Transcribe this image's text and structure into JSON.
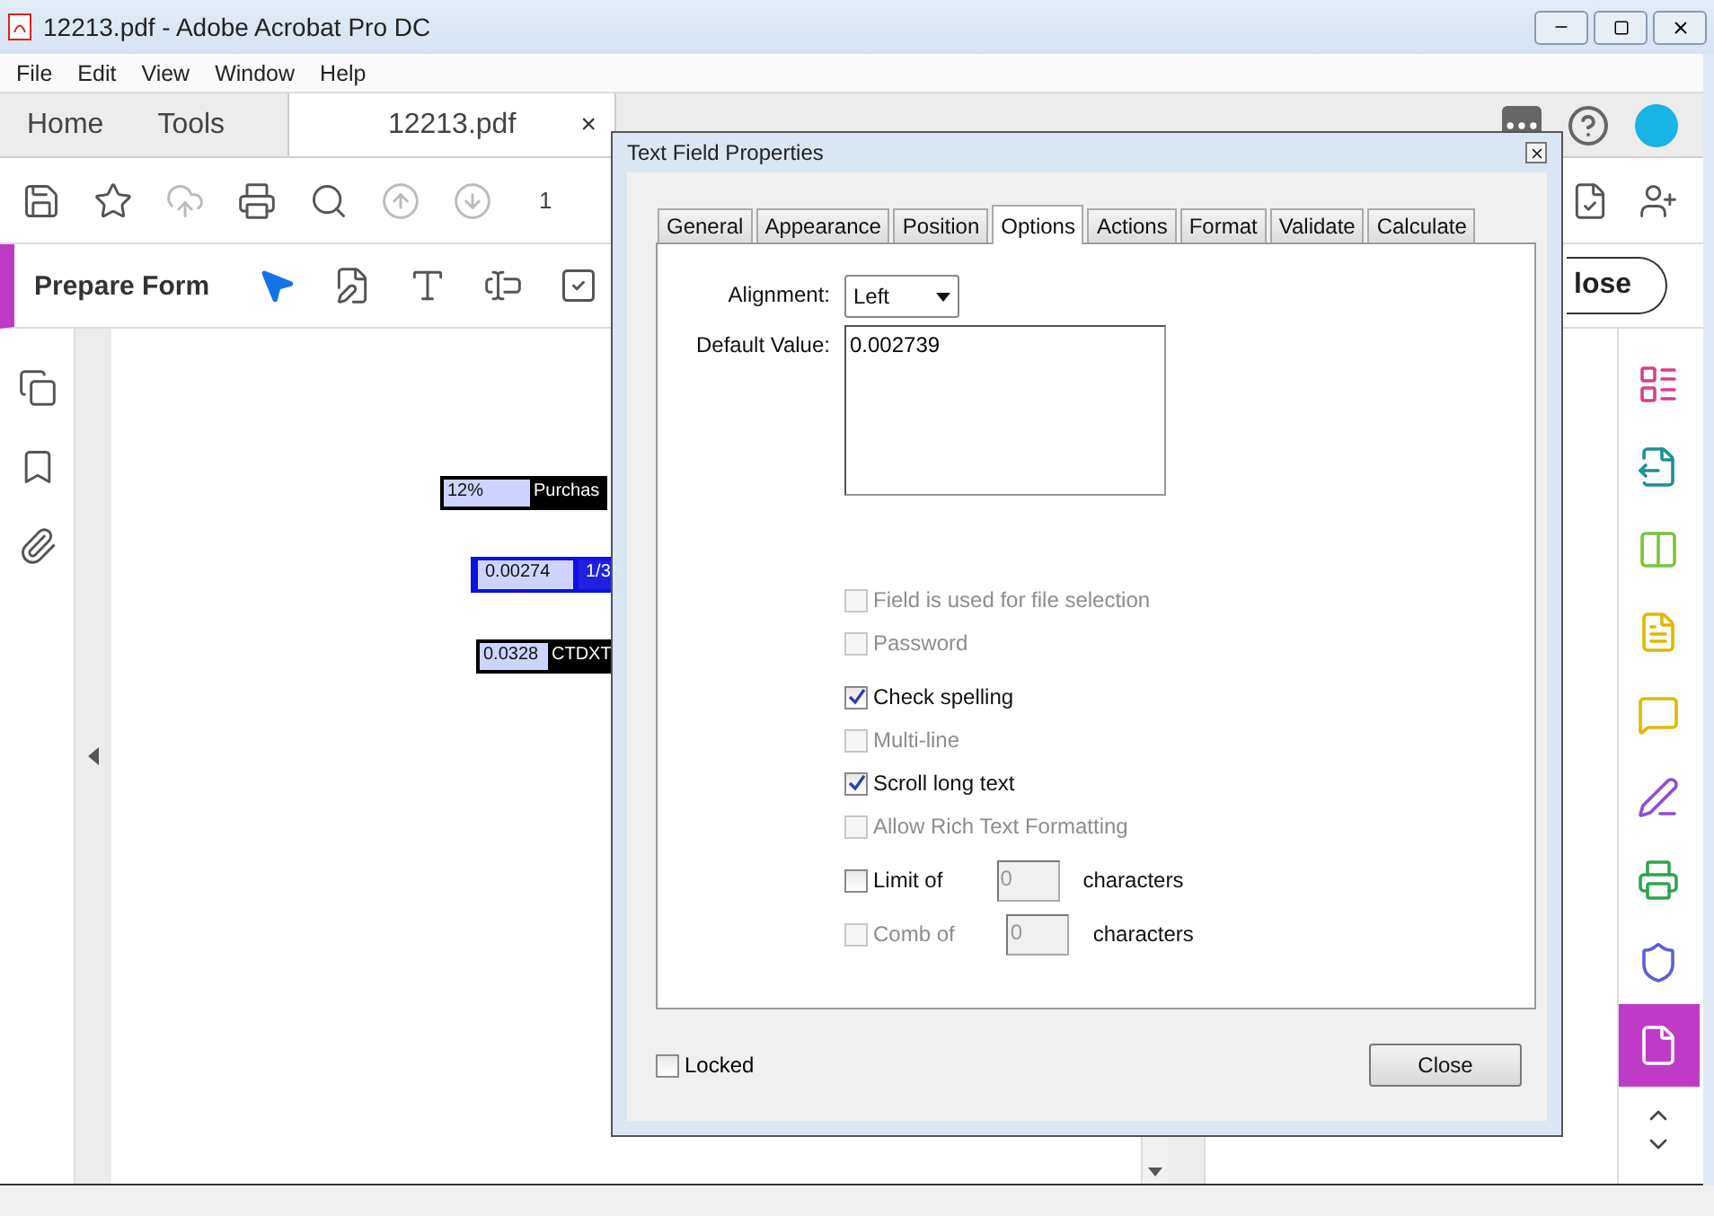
{
  "window": {
    "title": "12213.pdf - Adobe Acrobat Pro DC"
  },
  "menu": [
    "File",
    "Edit",
    "View",
    "Window",
    "Help"
  ],
  "app_tabs": [
    {
      "label": "Home",
      "selected": false
    },
    {
      "label": "Tools",
      "selected": false
    },
    {
      "label": "12213.pdf",
      "selected": true,
      "closable": "×"
    }
  ],
  "toolbar": {
    "page_number": "1"
  },
  "prepare_form": {
    "title": "Prepare Form",
    "close_button": "lose"
  },
  "page_fields": [
    {
      "value": "12%",
      "label": "Purchas",
      "selected": false
    },
    {
      "value": "0.00274",
      "label": "1/3",
      "selected": true
    },
    {
      "value": "0.0328",
      "label": "CTDXT",
      "selected": false
    }
  ],
  "tool_rail": [
    {
      "color": "#d63f8c",
      "selected": false
    },
    {
      "color": "#1f8f8f",
      "selected": false
    },
    {
      "color": "#7cc242",
      "selected": false
    },
    {
      "color": "#e0b800",
      "selected": false
    },
    {
      "color": "#e0b800",
      "selected": false
    },
    {
      "color": "#8a4fd8",
      "selected": false
    },
    {
      "color": "#2ea44f",
      "selected": false
    },
    {
      "color": "#5b5fd6",
      "selected": false
    },
    {
      "color": "#ffffff",
      "selected": true
    }
  ],
  "dialog": {
    "title": "Text Field Properties",
    "tabs": [
      {
        "label": "General",
        "selected": false
      },
      {
        "label": "Appearance",
        "selected": false
      },
      {
        "label": "Position",
        "selected": false
      },
      {
        "label": "Options",
        "selected": true
      },
      {
        "label": "Actions",
        "selected": false
      },
      {
        "label": "Format",
        "selected": false
      },
      {
        "label": "Validate",
        "selected": false
      },
      {
        "label": "Calculate",
        "selected": false
      }
    ],
    "alignment": {
      "label": "Alignment:",
      "value": "Left"
    },
    "default_value": {
      "label": "Default Value:",
      "value": "0.002739"
    },
    "options": [
      {
        "kind": "check",
        "label": "Field is used for file selection",
        "checked": false,
        "disabled": true
      },
      {
        "kind": "check",
        "label": "Password",
        "checked": false,
        "disabled": true
      },
      {
        "kind": "check",
        "label": "Check spelling",
        "checked": true,
        "disabled": false
      },
      {
        "kind": "check",
        "label": "Multi-line",
        "checked": false,
        "disabled": true
      },
      {
        "kind": "check",
        "label": "Scroll long text",
        "checked": true,
        "disabled": false
      },
      {
        "kind": "check",
        "label": "Allow Rich Text Formatting",
        "checked": false,
        "disabled": true
      },
      {
        "kind": "count",
        "label": "Limit of",
        "checked": false,
        "disabled": false,
        "value": "0",
        "suffix": "characters"
      },
      {
        "kind": "count",
        "label": "Comb of",
        "checked": false,
        "disabled": true,
        "value": "0",
        "suffix": "characters"
      }
    ],
    "locked": {
      "label": "Locked",
      "checked": false
    },
    "close_button": "Close"
  }
}
